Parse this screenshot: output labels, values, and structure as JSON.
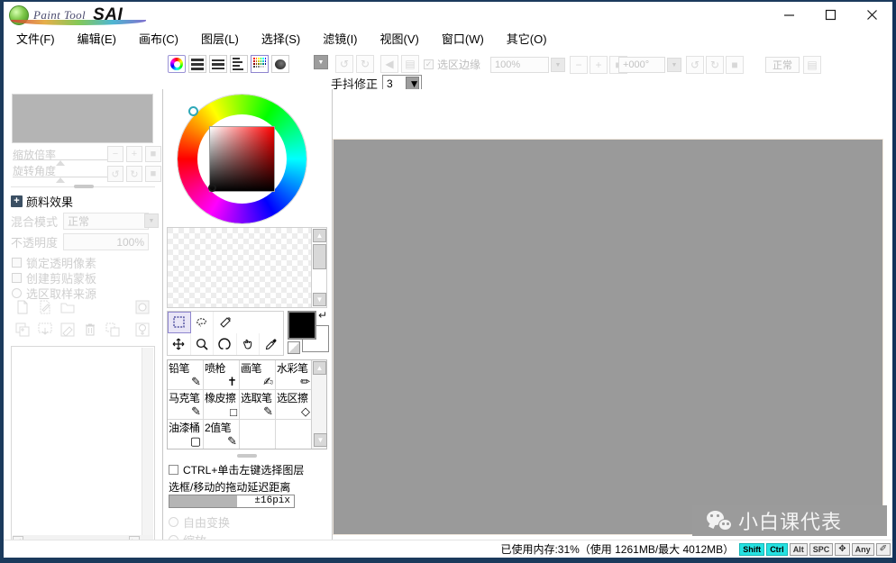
{
  "window": {
    "brand_paint_tool": "Paint Tool",
    "brand_sai": "SAI",
    "controls": [
      {
        "name": "minimize",
        "glyph": "—"
      },
      {
        "name": "maximize",
        "glyph": "□"
      },
      {
        "name": "close",
        "glyph": "✕"
      }
    ]
  },
  "menubar": {
    "items": [
      {
        "label": "文件(F)",
        "key": "F"
      },
      {
        "label": "编辑(E)",
        "key": "E"
      },
      {
        "label": "画布(C)",
        "key": "C"
      },
      {
        "label": "图层(L)",
        "key": "L"
      },
      {
        "label": "选择(S)",
        "key": "S"
      },
      {
        "label": "滤镜(I)",
        "key": "I"
      },
      {
        "label": "视图(V)",
        "key": "V"
      },
      {
        "label": "窗口(W)",
        "key": "W"
      },
      {
        "label": "其它(O)",
        "key": "O"
      }
    ]
  },
  "toolbar": {
    "palette_buttons": [
      {
        "name": "color-wheel-toggle",
        "icon": "color-wheel-icon"
      },
      {
        "name": "swatch-bars-toggle",
        "icon": "bars-icon"
      },
      {
        "name": "swatch-gradient-toggle",
        "icon": "gradient-bars-icon"
      },
      {
        "name": "swatch-list-toggle",
        "icon": "list-icon"
      },
      {
        "name": "swatch-grid-toggle",
        "icon": "grid-icon"
      },
      {
        "name": "swatch-blob-toggle",
        "icon": "blob-icon"
      }
    ],
    "nav_dropdown": "▼",
    "undo_label": "↺",
    "redo_label": "↻",
    "flip_h_label": "◀",
    "flip_v_label": "▤",
    "selection_edge_label": "选区边缘",
    "zoom_value": "100%",
    "zoom_minus": "−",
    "zoom_plus": "+",
    "zoom_reset": "■",
    "rotate_value": "+000°",
    "rotate_ccw": "↺",
    "rotate_cw": "↻",
    "rotate_reset": "■",
    "view_mode_label": "正常",
    "view_mode_extra": "▤",
    "stabilizer_label": "手抖修正",
    "stabilizer_value": "3"
  },
  "left_panel": {
    "zoom_slider_label": "缩放倍率",
    "rotate_slider_label": "旋转角度",
    "zoom_buttons": [
      "−",
      "+",
      "■"
    ],
    "rotate_buttons": [
      "↺",
      "↻",
      "■"
    ],
    "paint_effect_label": "颜料效果",
    "blend_mode_label": "混合模式",
    "blend_mode_value": "正常",
    "opacity_label": "不透明度",
    "opacity_value": "100%",
    "lock_alpha_label": "锁定透明像素",
    "clipping_label": "创建剪贴蒙板",
    "selection_source_label": "选区取样来源",
    "layer_buttons": [
      {
        "name": "new-layer-button",
        "icon": "page-icon"
      },
      {
        "name": "new-linework-layer-button",
        "icon": "page-pen-icon"
      },
      {
        "name": "new-folder-button",
        "icon": "folder-icon"
      },
      {
        "name": "layer-mask-button",
        "icon": "mask-icon"
      },
      {
        "name": "merge-down-button",
        "icon": "merge-icon"
      },
      {
        "name": "transfer-down-button",
        "icon": "transfer-icon"
      },
      {
        "name": "clear-layer-button",
        "icon": "eraser-icon"
      },
      {
        "name": "delete-layer-button",
        "icon": "trash-icon"
      },
      {
        "name": "duplicate-layer-button",
        "icon": "duplicate-icon"
      },
      {
        "name": "add-mask-button",
        "icon": "add-mask-icon"
      }
    ]
  },
  "color_panel": {
    "hue": "red",
    "foreground_color": "#000000",
    "background_color": "#ffffff",
    "swap_icon": "swap-arrow-icon",
    "reset_icon": "reset-colors-icon"
  },
  "tool_palette": {
    "row1": [
      {
        "name": "rect-select-tool",
        "icon": "marquee-icon",
        "glyph": "⬚",
        "selected": true
      },
      {
        "name": "lasso-select-tool",
        "icon": "lasso-icon",
        "glyph": "❀"
      },
      {
        "name": "magic-wand-tool",
        "icon": "magic-wand-icon",
        "glyph": "✦"
      }
    ],
    "row2": [
      {
        "name": "move-tool",
        "icon": "move-arrows-icon",
        "glyph": "✥"
      },
      {
        "name": "zoom-tool",
        "icon": "magnifier-icon",
        "glyph": "⚲"
      },
      {
        "name": "rotate-tool",
        "icon": "rotate-icon",
        "glyph": "Ω"
      },
      {
        "name": "hand-tool",
        "icon": "hand-icon",
        "glyph": "✋"
      },
      {
        "name": "eyedropper-tool",
        "icon": "eyedropper-icon",
        "glyph": "✐"
      }
    ]
  },
  "brush_palette": {
    "brushes": [
      {
        "label": "铅笔",
        "icon": "pencil-icon"
      },
      {
        "label": "喷枪",
        "icon": "airbrush-icon"
      },
      {
        "label": "画笔",
        "icon": "brush-icon"
      },
      {
        "label": "水彩笔",
        "icon": "watercolor-icon"
      },
      {
        "label": "马克笔",
        "icon": "marker-icon"
      },
      {
        "label": "橡皮擦",
        "icon": "eraser-icon"
      },
      {
        "label": "选取笔",
        "icon": "select-pen-icon"
      },
      {
        "label": "选区擦",
        "icon": "select-eraser-icon"
      },
      {
        "label": "油漆桶",
        "icon": "bucket-icon"
      },
      {
        "label": "2值笔",
        "icon": "binary-pen-icon"
      }
    ]
  },
  "options": {
    "ctrl_click_label": "CTRL+单击左键选择图层",
    "drag_delay_label": "选框/移动的拖动延迟距离",
    "drag_delay_value": "±16pix",
    "free_transform_label": "自由变换",
    "scale_label": "缩放"
  },
  "statusbar": {
    "memory_text": "已使用内存:31%（使用 1261MB/最大 4012MB）",
    "keys": [
      {
        "label": "Shift",
        "active": true
      },
      {
        "label": "Ctrl",
        "active": true
      },
      {
        "label": "Alt",
        "active": false
      },
      {
        "label": "SPC",
        "active": false
      },
      {
        "label": "✥",
        "active": false
      },
      {
        "label": "Any",
        "active": false
      },
      {
        "label": "✐",
        "active": false
      }
    ]
  },
  "watermark": {
    "text": "小白课代表",
    "icon": "wechat-icon"
  }
}
